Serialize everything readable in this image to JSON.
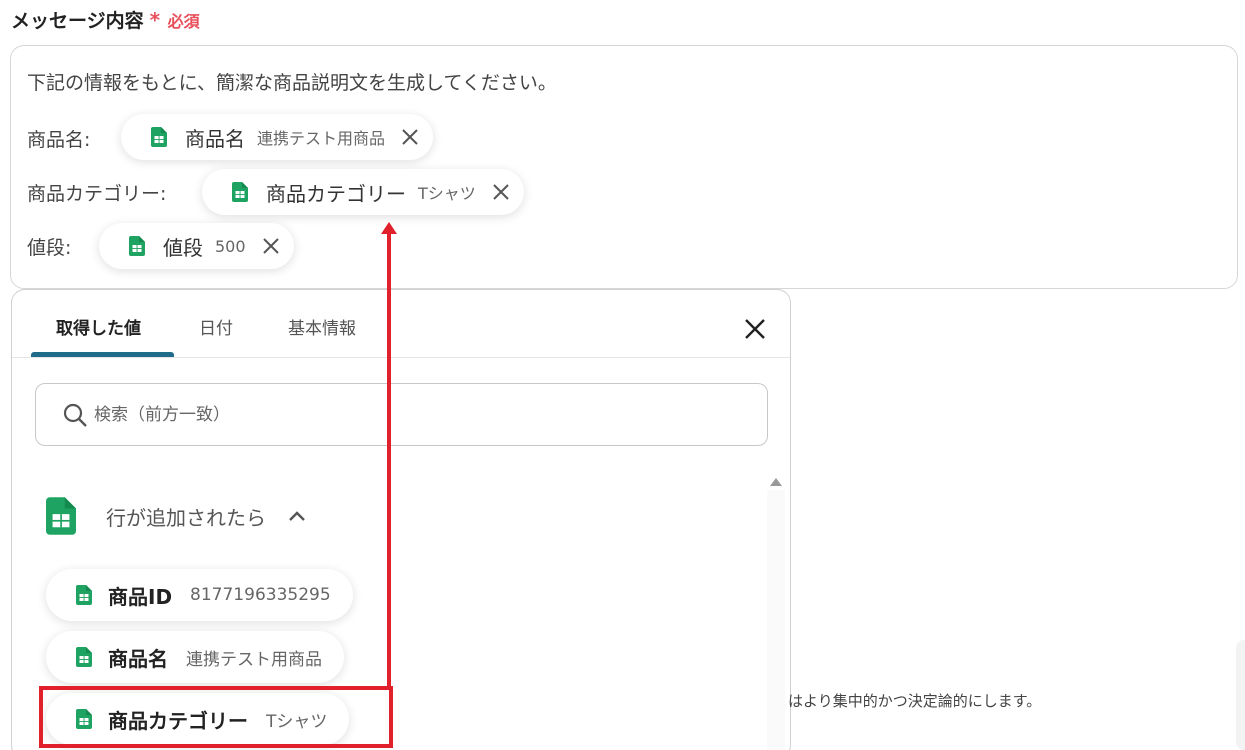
{
  "field": {
    "label": "メッセージ内容",
    "required_mark": "*",
    "required_text": "必須"
  },
  "message": {
    "intro": "下記の情報をもとに、簡潔な商品説明文を生成してください。",
    "rows": [
      {
        "label": "商品名:",
        "chip_name": "商品名",
        "chip_value": "連携テスト用商品"
      },
      {
        "label": "商品カテゴリー:",
        "chip_name": "商品カテゴリー",
        "chip_value": "Tシャツ"
      },
      {
        "label": "値段:",
        "chip_name": "値段",
        "chip_value": "500"
      }
    ]
  },
  "panel": {
    "tabs": [
      {
        "label": "取得した値",
        "active": true
      },
      {
        "label": "日付",
        "active": false
      },
      {
        "label": "基本情報",
        "active": false
      }
    ],
    "search": {
      "placeholder": "検索（前方一致）"
    },
    "group": {
      "title": "行が追加されたら"
    },
    "items": [
      {
        "name": "商品ID",
        "value": "8177196335295"
      },
      {
        "name": "商品名",
        "value": "連携テスト用商品"
      },
      {
        "name": "商品カテゴリー",
        "value": "Tシャツ"
      }
    ]
  },
  "helper_text": "はより集中的かつ決定論的にします。",
  "icons": {
    "sheet": "google-sheets-icon",
    "close": "close-icon",
    "search": "search-icon",
    "chevron": "chevron-up-icon"
  },
  "colors": {
    "required": "#e8505b",
    "sheets_green": "#1ea362",
    "tab_accent": "#1f6c8a",
    "annotation_red": "#e0202a"
  }
}
